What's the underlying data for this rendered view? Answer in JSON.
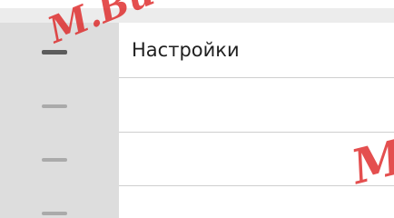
{
  "menu": {
    "settings_label": "Настройки"
  },
  "watermark": {
    "text_main": "М.Видео",
    "text_right": "М"
  },
  "colors": {
    "sidebar_bg": "#dddddd",
    "active_bar": "#5c5c5c",
    "inactive_bar": "#aaaaaa",
    "watermark_red": "#dc1e1e",
    "divider": "#cfcfcf"
  },
  "icons": {
    "menu_indicator": "menu-bar-icon"
  }
}
